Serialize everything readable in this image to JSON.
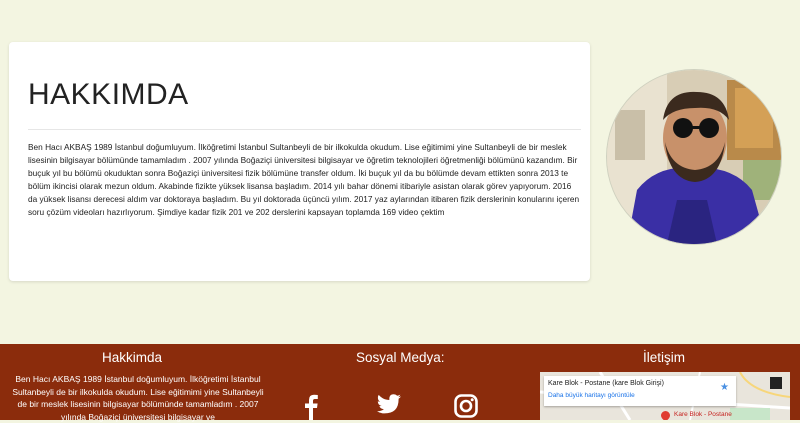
{
  "about": {
    "title": "HAKKIMDA",
    "text": "Ben Hacı AKBAŞ 1989 İstanbul doğumluyum. İlköğretimi İstanbul Sultanbeyli de bir ilkokulda okudum. Lise eğitimimi yine Sultanbeyli de bir meslek lisesinin bilgisayar bölümünde tamamladım . 2007 yılında Boğaziçi üniversitesi bilgisayar ve öğretim teknolojileri öğretmenliği bölümünü kazandım. Bir buçuk yıl bu bölümü okuduktan sonra Boğaziçi üniversitesi fizik bölümüne transfer oldum. İki buçuk yıl da bu bölümde devam ettikten sonra 2013 te bölüm ikincisi olarak mezun oldum. Akabinde fizikte yüksek lisansa başladım. 2014 yılı bahar dönemi itibariyle asistan olarak görev yapıyorum. 2016 da yüksek lisansı derecesi aldım var doktoraya başladım. Bu yıl doktorada üçüncü yılım. 2017 yaz aylarından itibaren fizik derslerinin konularını içeren soru çözüm videoları hazırlıyorum. Şimdiye kadar fizik 201 ve 202 derslerini kapsayan toplamda 169 video çektim"
  },
  "footer": {
    "about_title": "Hakkimda",
    "about_text": "Ben Hacı AKBAŞ 1989 İstanbul doğumluyum. İlköğretimi İstanbul Sultanbeyli de bir ilkokulda okudum. Lise eğitimimi yine Sultanbeyli de bir meslek lisesinin bilgisayar bölümünde tamamladım . 2007 yılında Boğaziçi üniversitesi bilgisayar ve",
    "social_title": "Sosyal Medya:",
    "social_icons": [
      "facebook-icon",
      "twitter-icon",
      "instagram-icon"
    ],
    "contact_title": "İletişim",
    "map": {
      "place_name": "Kare Blok - Postane (kare Blok Girişi)",
      "link_text": "Daha büyük haritayı görüntüle",
      "pin_label": "Kare Blok - Postane"
    }
  },
  "colors": {
    "page_bg": "#f3f5e1",
    "footer_bg": "#8b2c0c",
    "card_bg": "#ffffff"
  }
}
